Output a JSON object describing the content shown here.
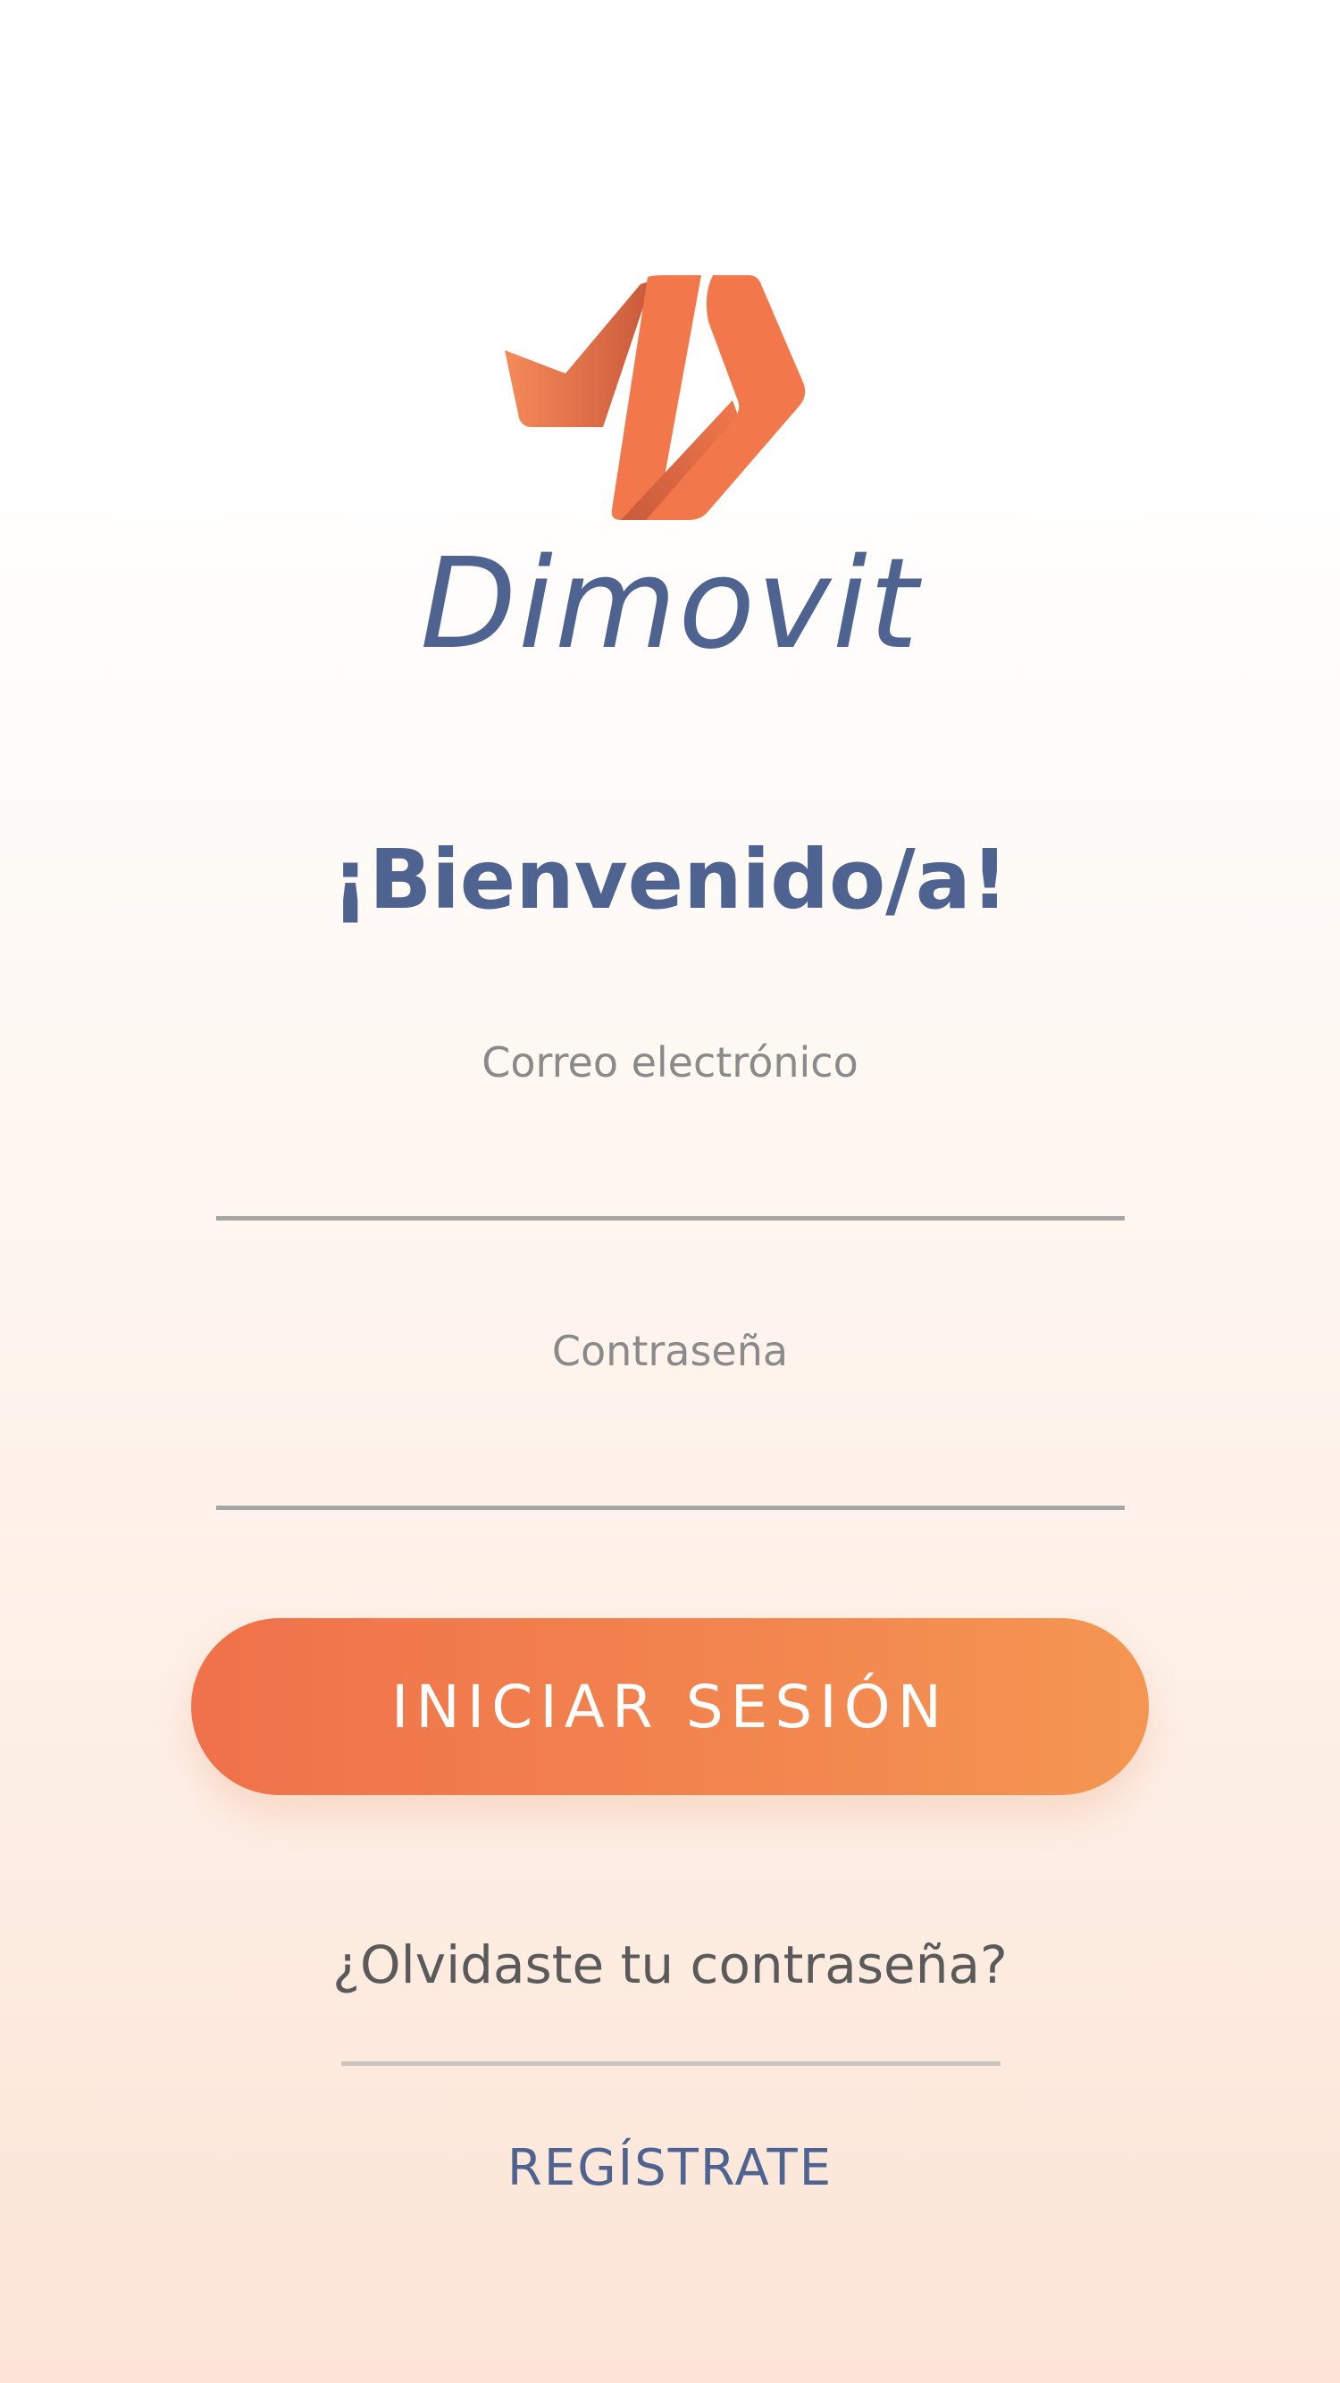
{
  "brand": {
    "name": "Dimovit",
    "logo_icon": "dimovit-logo-icon",
    "primary_color": "#f2784b",
    "text_color": "#4f6390"
  },
  "welcome": {
    "title": "¡Bienvenido/a!"
  },
  "form": {
    "email_label": "Correo electrónico",
    "email_value": "",
    "password_label": "Contraseña",
    "password_value": ""
  },
  "actions": {
    "login_label": "INICIAR SESIÓN",
    "forgot_label": "¿Olvidaste tu contraseña?",
    "register_label": "REGÍSTRATE"
  }
}
